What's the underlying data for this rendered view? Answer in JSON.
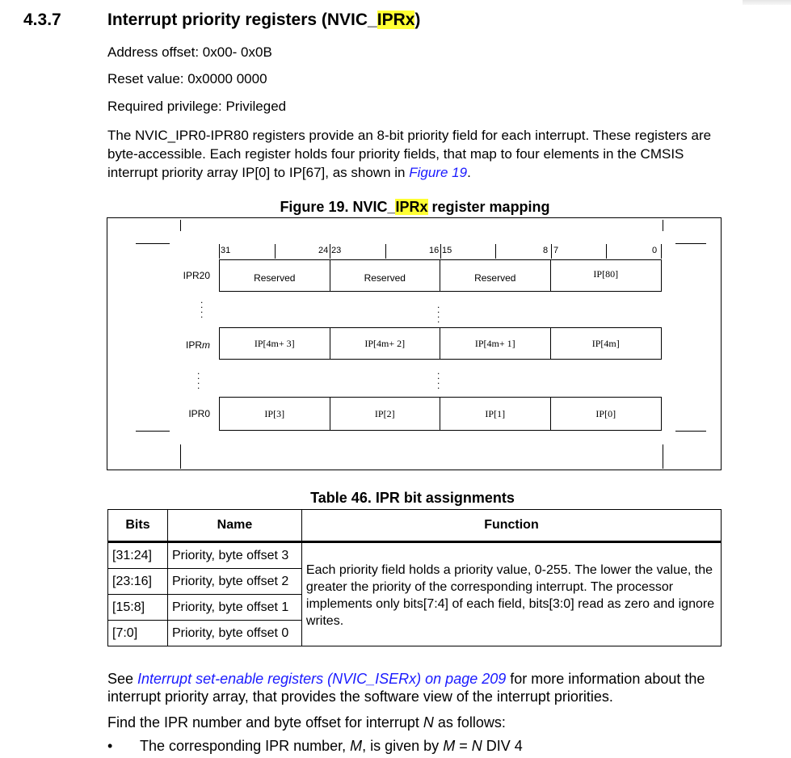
{
  "section": {
    "number": "4.3.7",
    "title_prefix": "Interrupt priority registers (NVIC_",
    "title_highlight": "IPRx",
    "title_suffix": ")"
  },
  "meta": {
    "address_offset": "Address offset: 0x00- 0x0B",
    "reset_value": "Reset value: 0x0000 0000",
    "privilege": "Required privilege: Privileged"
  },
  "description": {
    "text": "The NVIC_IPR0-IPR80 registers provide an 8-bit priority field for each interrupt. These registers are byte-accessible. Each register holds four priority fields, that map to four elements in the CMSIS interrupt priority array IP[0] to IP[67], as shown in ",
    "link": "Figure 19",
    "end": "."
  },
  "figure": {
    "title_prefix": "Figure 19. NVIC_",
    "title_highlight": "IPRx",
    "title_suffix": " register mapping",
    "bit_labels": [
      "31",
      "24",
      "23",
      "16",
      "15",
      "8",
      "7",
      "0"
    ],
    "rows": [
      {
        "name": "IPR20",
        "fields": [
          "Reserved",
          "Reserved",
          "Reserved",
          "IP[80]"
        ]
      },
      {
        "name_prefix": "IPR",
        "name_italic": "m",
        "fields": [
          "IP[4m+ 3]",
          "IP[4m+ 2]",
          "IP[4m+ 1]",
          "IP[4m]"
        ]
      },
      {
        "name": "IPR0",
        "fields": [
          "IP[3]",
          "IP[2]",
          "IP[1]",
          "IP[0]"
        ]
      }
    ]
  },
  "table": {
    "title": "Table 46. IPR bit assignments",
    "headers": [
      "Bits",
      "Name",
      "Function"
    ],
    "rows": [
      {
        "bits": "[31:24]",
        "name": "Priority, byte offset 3"
      },
      {
        "bits": "[23:16]",
        "name": "Priority, byte offset 2"
      },
      {
        "bits": "[15:8]",
        "name": "Priority, byte offset 1"
      },
      {
        "bits": "[7:0]",
        "name": "Priority, byte offset 0"
      }
    ],
    "function": "Each priority field holds a priority value, 0-255. The lower the value, the greater the priority of the corresponding interrupt. The processor implements only bits[7:4] of each field, bits[3:0] read as zero and ignore writes."
  },
  "footer": {
    "see": "See ",
    "see_link": "Interrupt set-enable registers (NVIC_ISERx) on page 209",
    "see_rest": " for more information about the interrupt priority array, that provides the software view of the interrupt priorities.",
    "find_prefix": "Find the IPR number and byte offset for interrupt ",
    "find_var": "N",
    "find_suffix": " as follows:",
    "bullet_symbol": "•",
    "bullet_prefix": "The corresponding IPR number, ",
    "bullet_var_m": "M",
    "bullet_mid": ", is given by ",
    "bullet_eq_m": "M",
    "bullet_eq": " = ",
    "bullet_eq_n": "N",
    "bullet_end": " DIV 4"
  },
  "colors": {
    "highlight": "#ffff33",
    "link": "#1a1aff"
  }
}
